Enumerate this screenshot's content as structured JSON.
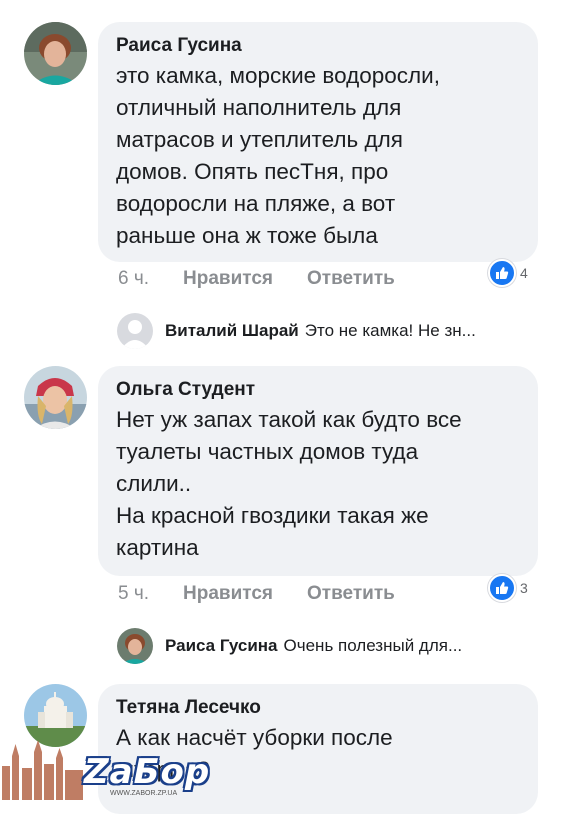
{
  "comments": [
    {
      "author": "Раиса Гусина",
      "text": "это камка, морские водоросли,\nотличный наполнитель для\nматрасов и утеплитель для\nдомов. Опять песТня, про\nводоросли на пляже, а вот\nраньше она ж тоже была",
      "time": "6 ч.",
      "like_label": "Нравится",
      "reply_label": "Ответить",
      "reaction_count": "4",
      "reply_preview": {
        "author": "Виталий Шарай",
        "text": "Это не камка! Не зн..."
      }
    },
    {
      "author": "Ольга Студент",
      "text": "Нет уж запах такой как будто все\nтуалеты частных домов туда\nслили..\nНа красной гвоздики такая же\nкартина",
      "time": "5 ч.",
      "like_label": "Нравится",
      "reply_label": "Ответить",
      "reaction_count": "3",
      "reply_preview": {
        "author": "Раиса Гусина",
        "text": "Очень полезный для..."
      }
    },
    {
      "author": "Тетяна Лесечко",
      "text": "А как насчёт уборки после\nшторма?"
    }
  ],
  "watermark": {
    "brand": "ZaБор",
    "url": "WWW.ZABOR.ZP.UA"
  },
  "colors": {
    "bubble": "#f0f2f5",
    "accent": "#1877f2",
    "meta": "#8a8d91"
  }
}
